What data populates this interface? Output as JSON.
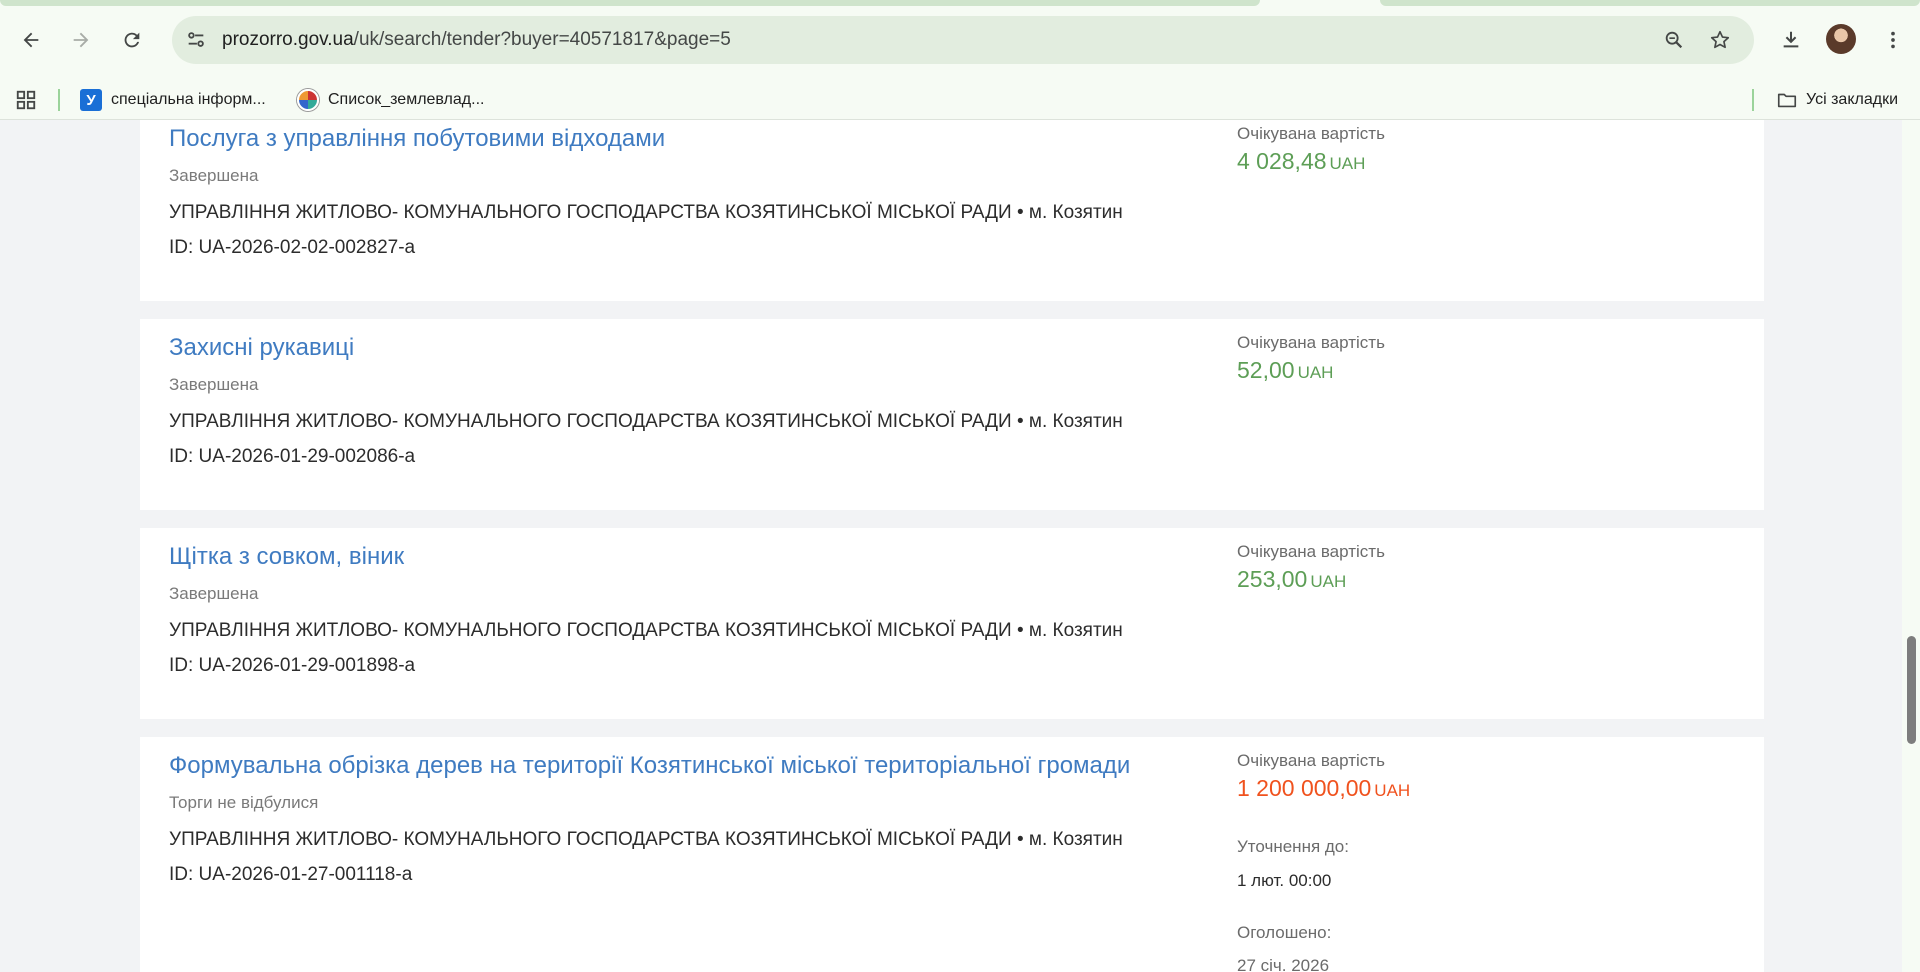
{
  "browser": {
    "url_host": "prozorro.gov.ua",
    "url_path": "/uk/search/tender?buyer=40571817&page=5",
    "icons": {
      "back": "arrow-left-icon",
      "forward": "arrow-right-icon",
      "reload": "reload-icon",
      "site_info": "tune-icon",
      "zoom": "zoom-icon",
      "bookmark": "star-icon",
      "downloads": "download-icon",
      "menu": "kebab-menu-icon"
    }
  },
  "bookmarks_bar": {
    "items": [
      {
        "label": "спеціальна інформ..."
      },
      {
        "label": "Список_землевлад..."
      }
    ],
    "all_bookmarks": "Усі закладки"
  },
  "tenders": [
    {
      "title": "Послуга з управління побутовими відходами",
      "status": "Завершена",
      "buyer": "УПРАВЛІННЯ ЖИТЛОВО- КОМУНАЛЬНОГО ГОСПОДАРСТВА КОЗЯТИНСЬКОЇ МІСЬКОЇ РАДИ • м. Козятин",
      "id": "ID: UA-2026-02-02-002827-a",
      "value_label": "Очікувана вартість",
      "value": "4 028,48",
      "currency": "UAH"
    },
    {
      "title": "Захисні рукавиці",
      "status": "Завершена",
      "buyer": "УПРАВЛІННЯ ЖИТЛОВО- КОМУНАЛЬНОГО ГОСПОДАРСТВА КОЗЯТИНСЬКОЇ МІСЬКОЇ РАДИ • м. Козятин",
      "id": "ID: UA-2026-01-29-002086-a",
      "value_label": "Очікувана вартість",
      "value": "52,00",
      "currency": "UAH"
    },
    {
      "title": "Щітка з совком, віник",
      "status": "Завершена",
      "buyer": "УПРАВЛІННЯ ЖИТЛОВО- КОМУНАЛЬНОГО ГОСПОДАРСТВА КОЗЯТИНСЬКОЇ МІСЬКОЇ РАДИ • м. Козятин",
      "id": "ID: UA-2026-01-29-001898-a",
      "value_label": "Очікувана вартість",
      "value": "253,00",
      "currency": "UAH"
    },
    {
      "title": "Формувальна обрізка дерев на території Козятинської міської територіальної громади",
      "status": "Торги не відбулися",
      "buyer": "УПРАВЛІННЯ ЖИТЛОВО- КОМУНАЛЬНОГО ГОСПОДАРСТВА КОЗЯТИНСЬКОЇ МІСЬКОЇ РАДИ • м. Козятин",
      "id": "ID: UA-2026-01-27-001118-a",
      "value_label": "Очікувана вартість",
      "value": "1 200 000,00",
      "currency": "UAH",
      "clarification_label": "Уточнення до:",
      "clarification_value": "1 лют. 00:00",
      "announced_label": "Оголошено:",
      "announced_value": "27 січ. 2026"
    }
  ],
  "colors": {
    "link": "#3f7bc1",
    "value_green": "#5d9e56",
    "value_red": "#f0521e"
  }
}
